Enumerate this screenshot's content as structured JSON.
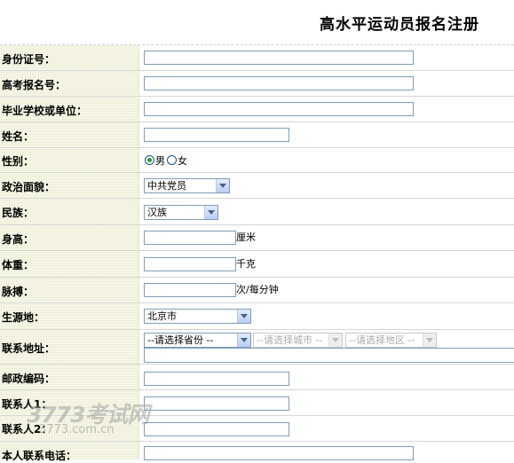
{
  "title": "高水平运动员报名注册",
  "fields": {
    "id_number": "身份证号：",
    "exam_number": "高考报名号：",
    "school": "毕业学校或单位：",
    "name": "姓名：",
    "gender": "性别：",
    "political": "政治面貌：",
    "ethnicity": "民族：",
    "height": "身高：",
    "weight": "体重：",
    "pulse": "脉搏：",
    "origin": "生源地：",
    "address": "联系地址：",
    "postcode": "邮政编码：",
    "contact1": "联系人1：",
    "contact2": "联系人2：",
    "next": "本人联系电话："
  },
  "gender_options": {
    "male": "男",
    "female": "女",
    "selected": "男"
  },
  "selects": {
    "political": "中共党员",
    "ethnicity": "汉族",
    "origin": "北京市",
    "province": "--请选择省份 --",
    "city": "--请选择城市 --",
    "district": "--请选择地区 --"
  },
  "units": {
    "height": "厘米",
    "weight": "千克",
    "pulse": "次/每分钟"
  },
  "watermark": {
    "main": "3773考试网",
    "sub": "3773.com.cn"
  }
}
